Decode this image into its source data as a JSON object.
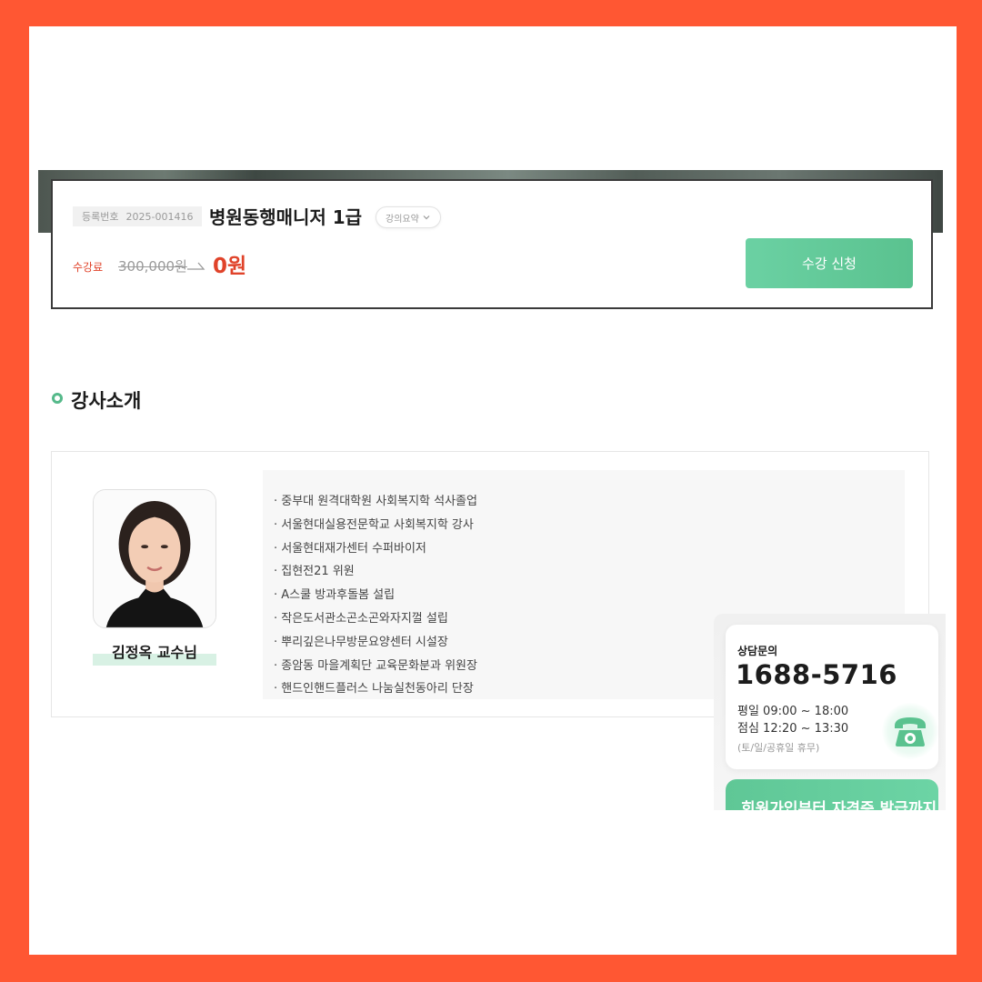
{
  "course": {
    "reg_label": "등록번호",
    "reg_number": "2025-001416",
    "title": "병원동행매니저 1급",
    "summary_button": "강의요약",
    "fee_label": "수강료",
    "original_price": "300,000원",
    "sale_price": "0원",
    "apply_button": "수강 신청"
  },
  "instructor_section": {
    "title": "강사소개",
    "name": "김정옥 교수님",
    "career": [
      "· 중부대 원격대학원 사회복지학 석사졸업",
      "· 서울현대실용전문학교 사회복지학 강사",
      "· 서울현대재가센터 수퍼바이저",
      "· 집현전21 위원",
      "· A스쿨 방과후돌봄 설립",
      "· 작은도서관소곤소곤와자지껄 설립",
      "· 뿌리깊은나무방문요양센터 시설장",
      "· 종암동 마을계획단 교육문화분과 위원장",
      "· 핸드인핸드플러스 나눔실천동아리 단장"
    ]
  },
  "consult_widget": {
    "label": "상담문의",
    "phone": "1688-5716",
    "weekday": "평일 09:00 ~ 18:00",
    "lunch": "점심 12:20 ~ 13:30",
    "closed": "(토/일/공휴일 휴무)",
    "icon": "phone-icon",
    "banner_text": "회원가입부터 자격증 발급까지"
  },
  "colors": {
    "frame": "#ff5733",
    "accent_green": "#5ac28f",
    "price_red": "#e0432a"
  }
}
